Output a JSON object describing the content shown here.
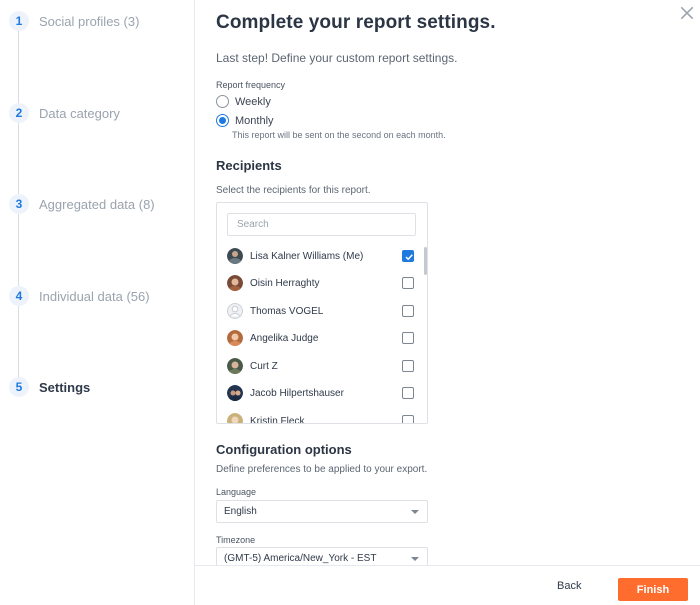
{
  "stepper": {
    "steps": [
      {
        "number": "1",
        "label": "Social profiles (3)",
        "active": false
      },
      {
        "number": "2",
        "label": "Data category",
        "active": false
      },
      {
        "number": "3",
        "label": "Aggregated data (8)",
        "active": false
      },
      {
        "number": "4",
        "label": "Individual data (56)",
        "active": false
      },
      {
        "number": "5",
        "label": "Settings",
        "active": true
      }
    ]
  },
  "main": {
    "title": "Complete your report settings.",
    "subtitle": "Last step! Define your custom report settings.",
    "close_icon": "close-icon"
  },
  "frequency": {
    "label": "Report frequency",
    "options": [
      {
        "label": "Weekly",
        "checked": false
      },
      {
        "label": "Monthly",
        "checked": true
      }
    ],
    "helper": "This report will be sent on the second on each month."
  },
  "recipients": {
    "title": "Recipients",
    "description": "Select the recipients for this report.",
    "search_placeholder": "Search",
    "people": [
      {
        "name": "Lisa Kalner Williams (Me)",
        "checked": true
      },
      {
        "name": "Oisin Herraghty",
        "checked": false
      },
      {
        "name": "Thomas VOGEL",
        "checked": false
      },
      {
        "name": "Angelika Judge",
        "checked": false
      },
      {
        "name": "Curt Z",
        "checked": false
      },
      {
        "name": "Jacob Hilpertshauser",
        "checked": false
      },
      {
        "name": "Kristin Fleck",
        "checked": false
      }
    ]
  },
  "configuration": {
    "title": "Configuration options",
    "description": "Define preferences to be applied to your export.",
    "language_label": "Language",
    "language_value": "English",
    "timezone_label": "Timezone",
    "timezone_value": "(GMT-5) America/New_York - EST"
  },
  "footer": {
    "back_label": "Back",
    "finish_label": "Finish"
  },
  "colors": {
    "accent": "#1f7ae0",
    "finish": "#ff6d2e"
  }
}
